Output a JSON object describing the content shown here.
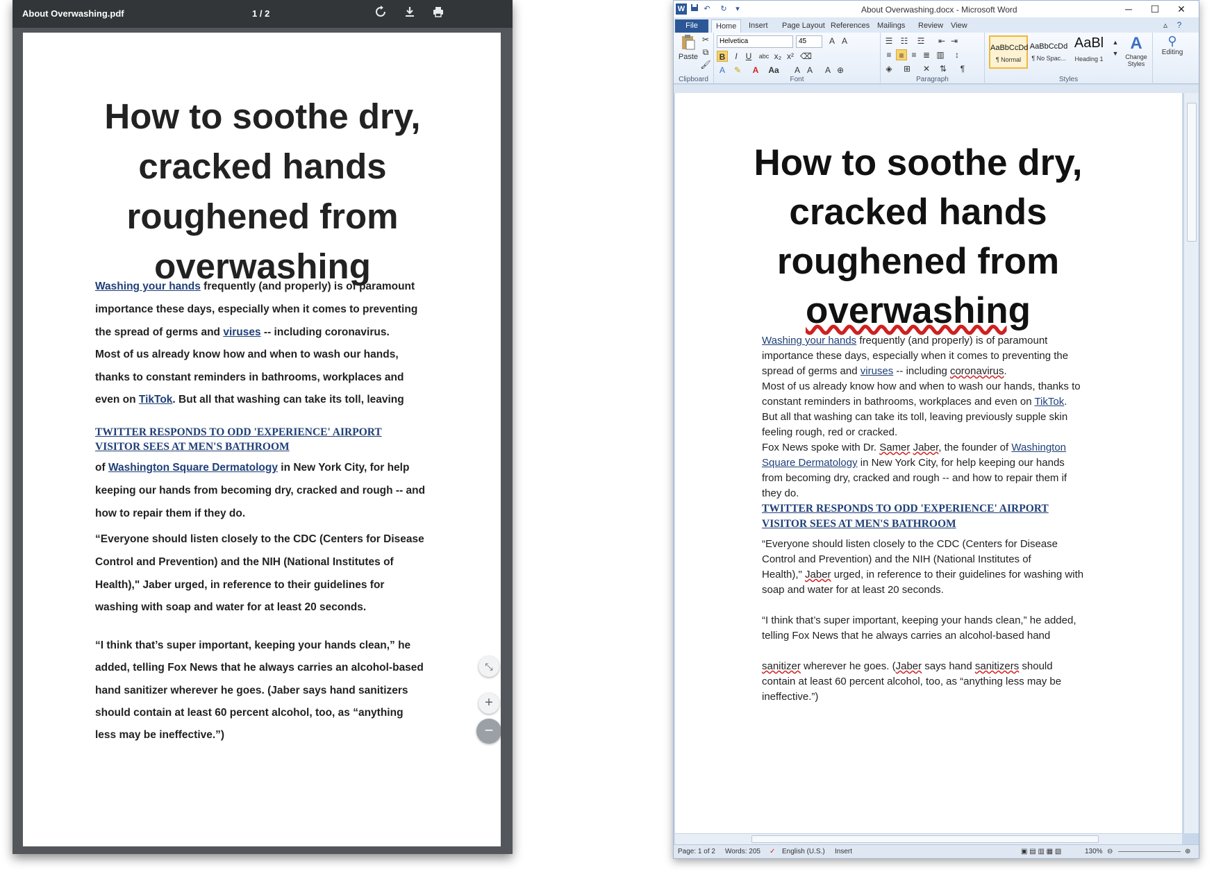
{
  "pdf": {
    "filename": "About Overwashing.pdf",
    "page_indicator": "1 / 2",
    "toolbar": {
      "rotate_icon": "rotate-icon",
      "download_icon": "download-icon",
      "print_icon": "print-icon"
    },
    "title_lines": [
      "How to soothe dry,",
      "cracked hands",
      "roughened from",
      "overwashing"
    ],
    "p1_link": "Washing your hands",
    "p1_a": " frequently (and properly) is of paramount",
    "p1_line2": "importance these days, especially when it comes to preventing",
    "p1_line3a": "the spread of germs and ",
    "p1_link2": "viruses",
    "p1_line3b": " -- including coronavirus.",
    "p2_line1": "Most of us already know how and when to wash our hands,",
    "p2_line2": "thanks to constant reminders in bathrooms, workplaces and",
    "p2_line3a": "even on ",
    "p2_link": "TikTok",
    "p2_line3b": ". But all that washing can take its toll, leaving",
    "headline_line1": "TWITTER RESPONDS TO ODD 'EXPERIENCE' AIRPORT",
    "headline_line2": "VISITOR SEES AT MEN'S BATHROOM",
    "p3_line1a": "of ",
    "p3_link": "Washington Square Dermatology",
    "p3_line1b": " in New York City, for help",
    "p3_line2": "keeping our hands from becoming dry, cracked and rough -- and",
    "p3_line3": "how to repair them if they do.",
    "p4_line1": "“Everyone should listen closely to the CDC (Centers for Disease",
    "p4_line2": "Control and Prevention) and the NIH (National Institutes of",
    "p4_line3": "Health),\" Jaber urged, in reference to their guidelines for",
    "p4_line4": "washing with soap and water for at least 20 seconds.",
    "p5_line1": "“I think that’s super important, keeping your hands clean,” he",
    "p5_line2": "added, telling Fox News that he always carries an alcohol-based",
    "p5_line3": "hand sanitizer wherever he goes. (Jaber says hand sanitizers",
    "p5_line4": "should contain at least 60 percent alcohol, too, as “anything",
    "p5_line5": "less may be ineffective.”)",
    "fab_fit": "⤡",
    "fab_plus": "+",
    "fab_minus": "−"
  },
  "word": {
    "window_title": "About Overwashing.docx - Microsoft Word",
    "tabs": [
      "File",
      "Home",
      "Insert",
      "Page Layout",
      "References",
      "Mailings",
      "Review",
      "View"
    ],
    "ribbon": {
      "paste": "Paste",
      "font_name": "Helvetica",
      "font_size": "45",
      "groups": {
        "clipboard": "Clipboard",
        "font": "Font",
        "paragraph": "Paragraph",
        "styles": "Styles"
      },
      "styles": [
        {
          "sample": "AaBbCcDd",
          "name": "¶ Normal"
        },
        {
          "sample": "AaBbCcDd",
          "name": "¶ No Spac..."
        },
        {
          "sample": "AaBl",
          "name": "Heading 1"
        }
      ],
      "change_styles": "Change Styles",
      "editing": "Editing"
    },
    "title_lines": [
      "How to soothe dry,",
      "cracked hands",
      "roughened from",
      "overwashing"
    ],
    "p1_link": "Washing your hands",
    "p1_a": " frequently (and properly) is of paramount",
    "p1_line2": "importance these days, especially when it comes to preventing the",
    "p1_line3a": "spread of germs and ",
    "p1_link2": "viruses",
    "p1_line3b": " -- including ",
    "p1_line3c": "coronavirus",
    "p1_line3d": ".",
    "p2_line1": "Most of us already know how and when to wash our hands, thanks to",
    "p2_line2a": "constant reminders in bathrooms, workplaces and even on ",
    "p2_link": "TikTok",
    "p2_line2b": ".",
    "p2_line3": "But all that washing can take its toll, leaving previously supple skin",
    "p2_line4": "feeling rough, red or cracked.",
    "p3_line1a": "Fox News spoke with Dr. ",
    "p3_name1": "Samer",
    "p3_sp": " ",
    "p3_name2": "Jaber",
    "p3_line1b": ", the founder of ",
    "p3_link_a": "Washington ",
    "p3_link_b": "Square Dermatology",
    "p3_line2b": " in New York City, for help keeping our hands",
    "p3_line3": "from becoming dry, cracked and rough -- and how to repair them if",
    "p3_line4": "they do.",
    "headline_line1": "TWITTER RESPONDS TO ODD 'EXPERIENCE' AIRPORT",
    "headline_line2": "VISITOR SEES AT MEN'S BATHROOM",
    "p4_line1": "“Everyone should listen closely to the CDC (Centers for Disease",
    "p4_line2": "Control and Prevention) and the NIH (National Institutes of",
    "p4_line3a": "Health),\" ",
    "p4_name": "Jaber",
    "p4_line3b": " urged, in reference to their guidelines for washing with",
    "p4_line4": "soap and water for at least 20 seconds.",
    "p5_line1": "“I think that’s super important, keeping your hands clean,” he added,",
    "p5_line2": "telling Fox News that he always carries an alcohol-based hand",
    "p6_w1": "sanitizer",
    "p6_a": " wherever he goes. (",
    "p6_w2": "Jaber",
    "p6_b": " says hand ",
    "p6_w3": "sanitizers",
    "p6_c": " should",
    "p6_line2": "contain at least 60 percent alcohol, too, as “anything less may be",
    "p6_line3": "ineffective.”)",
    "status": {
      "page": "Page: 1 of 2",
      "words": "Words: 205",
      "language": "English (U.S.)",
      "mode": "Insert",
      "zoom": "130%"
    }
  }
}
